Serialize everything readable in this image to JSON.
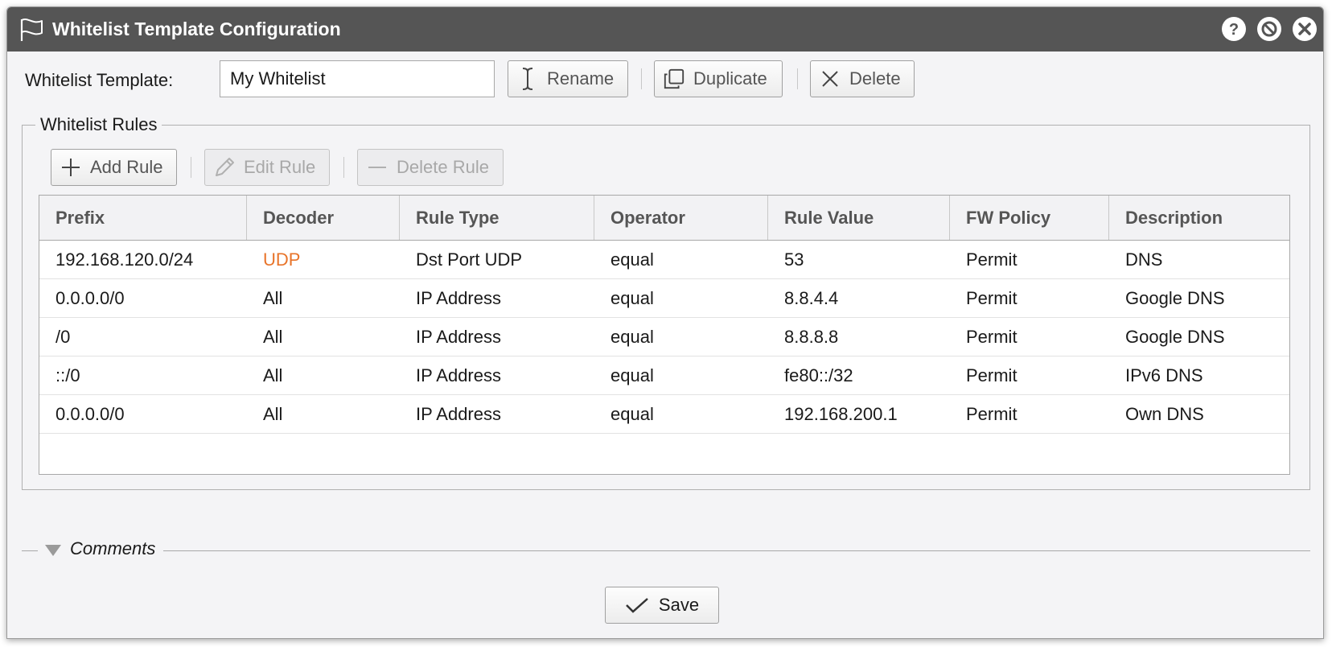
{
  "window": {
    "title": "Whitelist Template Configuration",
    "controls": [
      "help-icon",
      "minimize-icon",
      "close-icon"
    ]
  },
  "template": {
    "label": "Whitelist Template:",
    "value": "My Whitelist",
    "rename_label": "Rename",
    "duplicate_label": "Duplicate",
    "delete_label": "Delete"
  },
  "rules": {
    "legend": "Whitelist Rules",
    "add_label": "Add Rule",
    "edit_label": "Edit Rule",
    "delete_label": "Delete Rule",
    "columns": [
      "Prefix",
      "Decoder",
      "Rule Type",
      "Operator",
      "Rule Value",
      "FW Policy",
      "Description"
    ],
    "rows": [
      [
        "192.168.120.0/24",
        "UDP",
        "Dst Port UDP",
        "equal",
        "53",
        "Permit",
        "DNS"
      ],
      [
        "0.0.0.0/0",
        "All",
        "IP Address",
        "equal",
        "8.8.4.4",
        "Permit",
        "Google DNS"
      ],
      [
        "/0",
        "All",
        "IP Address",
        "equal",
        "8.8.8.8",
        "Permit",
        "Google DNS"
      ],
      [
        "::/0",
        "All",
        "IP Address",
        "equal",
        "fe80::/32",
        "Permit",
        "IPv6 DNS"
      ],
      [
        "0.0.0.0/0",
        "All",
        "IP Address",
        "equal",
        "192.168.200.1",
        "Permit",
        "Own DNS"
      ]
    ],
    "highlight_color": "#e8742a"
  },
  "comments": {
    "label": "Comments"
  },
  "footer": {
    "save_label": "Save"
  },
  "colors": {
    "titlebar": "#555555",
    "accent": "#e8742a"
  }
}
